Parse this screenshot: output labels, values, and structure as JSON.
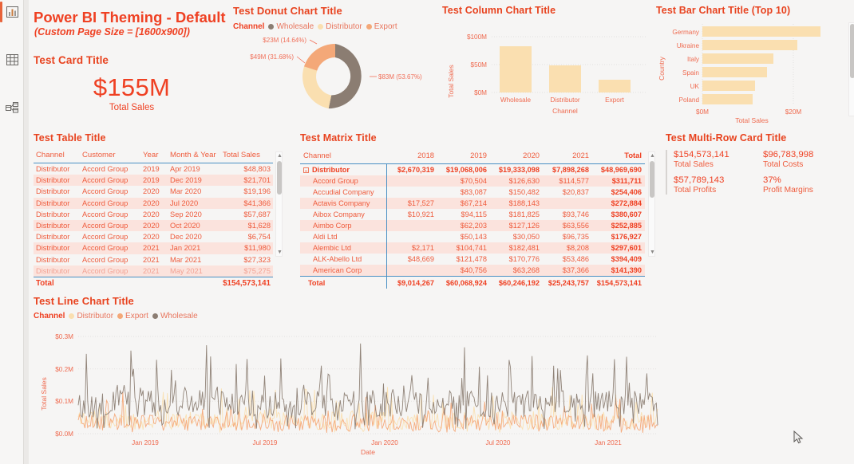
{
  "nav": {
    "items": [
      {
        "name": "report-view",
        "icon": "report-bar-icon",
        "selected": true
      },
      {
        "name": "data-view",
        "icon": "table-grid-icon",
        "selected": false
      },
      {
        "name": "model-view",
        "icon": "model-relationship-icon",
        "selected": false
      }
    ]
  },
  "page": {
    "title": "Power BI Theming - Default",
    "subtitle": "(Custom Page Size = [1600x900])",
    "accent": "#ef4123",
    "canvas_bg": "#f6f5f4"
  },
  "card": {
    "title": "Test Card Title",
    "value": "$155M",
    "label": "Total Sales"
  },
  "donut": {
    "title": "Test Donut Chart Title",
    "legend_title": "Channel"
  },
  "column": {
    "title": "Test Column Chart Title"
  },
  "bar": {
    "title": "Test Bar Chart Title (Top 10)"
  },
  "table": {
    "title": "Test Table Title",
    "columns": [
      "Channel",
      "Customer",
      "Year",
      "Month & Year",
      "Total Sales"
    ],
    "rows": [
      [
        "Distributor",
        "Accord Group",
        "2019",
        "Apr 2019",
        "$48,803"
      ],
      [
        "Distributor",
        "Accord Group",
        "2019",
        "Dec 2019",
        "$21,701"
      ],
      [
        "Distributor",
        "Accord Group",
        "2020",
        "Mar 2020",
        "$19,196"
      ],
      [
        "Distributor",
        "Accord Group",
        "2020",
        "Jul 2020",
        "$41,366"
      ],
      [
        "Distributor",
        "Accord Group",
        "2020",
        "Sep 2020",
        "$57,687"
      ],
      [
        "Distributor",
        "Accord Group",
        "2020",
        "Oct 2020",
        "$1,628"
      ],
      [
        "Distributor",
        "Accord Group",
        "2020",
        "Dec 2020",
        "$6,754"
      ],
      [
        "Distributor",
        "Accord Group",
        "2021",
        "Jan 2021",
        "$11,980"
      ],
      [
        "Distributor",
        "Accord Group",
        "2021",
        "Mar 2021",
        "$27,323"
      ],
      [
        "Distributor",
        "Accord Group",
        "2021",
        "May 2021",
        "$75,275"
      ]
    ],
    "total_label": "Total",
    "total_value": "$154,573,141"
  },
  "matrix": {
    "title": "Test Matrix Title",
    "columns": [
      "Channel",
      "2018",
      "2019",
      "2020",
      "2021",
      "Total"
    ],
    "group": {
      "label": "Distributor",
      "values": [
        "$2,670,319",
        "$19,068,006",
        "$19,333,098",
        "$7,898,268",
        "$48,969,690"
      ]
    },
    "rows": [
      {
        "label": "Accord Group",
        "values": [
          "",
          "$70,504",
          "$126,630",
          "$114,577",
          "$311,711"
        ]
      },
      {
        "label": "Accudial Company",
        "values": [
          "",
          "$83,087",
          "$150,482",
          "$20,837",
          "$254,406"
        ]
      },
      {
        "label": "Actavis Company",
        "values": [
          "$17,527",
          "$67,214",
          "$188,143",
          "",
          "$272,884"
        ]
      },
      {
        "label": "Aibox Company",
        "values": [
          "$10,921",
          "$94,115",
          "$181,825",
          "$93,746",
          "$380,607"
        ]
      },
      {
        "label": "Aimbo Corp",
        "values": [
          "",
          "$62,203",
          "$127,126",
          "$63,556",
          "$252,885"
        ]
      },
      {
        "label": "Aldi Ltd",
        "values": [
          "",
          "$50,143",
          "$30,050",
          "$96,735",
          "$176,927"
        ]
      },
      {
        "label": "Alembic Ltd",
        "values": [
          "$2,171",
          "$104,741",
          "$182,481",
          "$8,208",
          "$297,601"
        ]
      },
      {
        "label": "ALK-Abello Ltd",
        "values": [
          "$48,669",
          "$121,478",
          "$170,776",
          "$53,486",
          "$394,409"
        ]
      },
      {
        "label": "American Corp",
        "values": [
          "",
          "$40,756",
          "$63,268",
          "$37,366",
          "$141,390"
        ]
      }
    ],
    "total": {
      "label": "Total",
      "values": [
        "$9,014,267",
        "$60,068,924",
        "$60,246,192",
        "$25,243,757",
        "$154,573,141"
      ]
    }
  },
  "multirow": {
    "title": "Test Multi-Row Card Title",
    "cells": [
      {
        "value": "$154,573,141",
        "label": "Total Sales"
      },
      {
        "value": "$96,783,998",
        "label": "Total Costs"
      },
      {
        "value": "$57,789,143",
        "label": "Total Profits"
      },
      {
        "value": "37%",
        "label": "Profit Margins"
      }
    ]
  },
  "line": {
    "title": "Test Line Chart Title",
    "legend_title": "Channel"
  },
  "colors": {
    "wholesale": "#8b7d72",
    "distributor": "#fadfb0",
    "export": "#f4a878",
    "bar_fill": "#fadfb0",
    "text": "#ef5b3c",
    "title": "#ef4123"
  },
  "chart_data": [
    {
      "type": "pie",
      "name": "donut",
      "title": "Test Donut Chart Title",
      "legend_title": "Channel",
      "legend_position": "top",
      "labels": [
        "Wholesale",
        "Distributor",
        "Export"
      ],
      "values": [
        83,
        49,
        23
      ],
      "percents": [
        53.67,
        31.68,
        14.64
      ],
      "data_labels": [
        "$83M (53.67%)",
        "$49M (31.68%)",
        "$23M (14.64%)"
      ],
      "colors": [
        "#8b7d72",
        "#fadfb0",
        "#f4a878"
      ]
    },
    {
      "type": "bar",
      "name": "column-chart",
      "title": "Test Column Chart Title",
      "categories": [
        "Wholesale",
        "Distributor",
        "Export"
      ],
      "values": [
        83,
        49,
        23
      ],
      "xlabel": "Channel",
      "ylabel": "Total Sales",
      "ylim": [
        0,
        100
      ],
      "yticks": [
        0,
        50,
        100
      ],
      "ytick_labels": [
        "$0M",
        "$50M",
        "$100M"
      ],
      "grid": true,
      "color": "#fadfb0"
    },
    {
      "type": "bar",
      "name": "bar-chart-top10",
      "orientation": "horizontal",
      "title": "Test Bar Chart Title (Top 10)",
      "categories": [
        "Germany",
        "Ukraine",
        "Italy",
        "Spain",
        "UK",
        "Poland"
      ],
      "values": [
        25.9,
        20.9,
        15.6,
        14.2,
        11.5,
        11.1
      ],
      "xlabel": "Total Sales",
      "ylabel": "Country",
      "xlim": [
        0,
        30
      ],
      "xticks": [
        0,
        20
      ],
      "xtick_labels": [
        "$0M",
        "$20M"
      ],
      "grid": true,
      "color": "#fadfb0",
      "scrollable": true
    },
    {
      "type": "line",
      "name": "line-chart",
      "title": "Test Line Chart Title",
      "legend_title": "Channel",
      "legend_position": "top",
      "xlabel": "Date",
      "ylabel": "Total Sales",
      "ylim": [
        0,
        0.3
      ],
      "yticks": [
        0,
        0.1,
        0.2,
        0.3
      ],
      "ytick_labels": [
        "$0.0M",
        "$0.1M",
        "$0.2M",
        "$0.3M"
      ],
      "xtick_labels": [
        "Jan 2019",
        "Jul 2019",
        "Jan 2020",
        "Jul 2020",
        "Jan 2021"
      ],
      "grid": true,
      "series": [
        {
          "name": "Distributor",
          "color": "#fadfb0"
        },
        {
          "name": "Export",
          "color": "#f4a878"
        },
        {
          "name": "Wholesale",
          "color": "#8b7d72"
        }
      ]
    },
    {
      "type": "table",
      "name": "table-visual",
      "title": "Test Table Title",
      "columns": [
        "Channel",
        "Customer",
        "Year",
        "Month & Year",
        "Total Sales"
      ],
      "rows": [
        [
          "Distributor",
          "Accord Group",
          "2019",
          "Apr 2019",
          "$48,803"
        ],
        [
          "Distributor",
          "Accord Group",
          "2019",
          "Dec 2019",
          "$21,701"
        ],
        [
          "Distributor",
          "Accord Group",
          "2020",
          "Mar 2020",
          "$19,196"
        ],
        [
          "Distributor",
          "Accord Group",
          "2020",
          "Jul 2020",
          "$41,366"
        ],
        [
          "Distributor",
          "Accord Group",
          "2020",
          "Sep 2020",
          "$57,687"
        ],
        [
          "Distributor",
          "Accord Group",
          "2020",
          "Oct 2020",
          "$1,628"
        ],
        [
          "Distributor",
          "Accord Group",
          "2020",
          "Dec 2020",
          "$6,754"
        ],
        [
          "Distributor",
          "Accord Group",
          "2021",
          "Jan 2021",
          "$11,980"
        ],
        [
          "Distributor",
          "Accord Group",
          "2021",
          "Mar 2021",
          "$27,323"
        ],
        [
          "Distributor",
          "Accord Group",
          "2021",
          "May 2021",
          "$75,275"
        ]
      ],
      "total_row": [
        "Total",
        "",
        "",
        "",
        "$154,573,141"
      ]
    },
    {
      "type": "table",
      "name": "matrix-visual",
      "title": "Test Matrix Title",
      "columns": [
        "Channel",
        "2018",
        "2019",
        "2020",
        "2021",
        "Total"
      ],
      "rows": [
        [
          "Distributor",
          "$2,670,319",
          "$19,068,006",
          "$19,333,098",
          "$7,898,268",
          "$48,969,690"
        ],
        [
          "Accord Group",
          "",
          "$70,504",
          "$126,630",
          "$114,577",
          "$311,711"
        ],
        [
          "Accudial Company",
          "",
          "$83,087",
          "$150,482",
          "$20,837",
          "$254,406"
        ],
        [
          "Actavis Company",
          "$17,527",
          "$67,214",
          "$188,143",
          "",
          "$272,884"
        ],
        [
          "Aibox Company",
          "$10,921",
          "$94,115",
          "$181,825",
          "$93,746",
          "$380,607"
        ],
        [
          "Aimbo Corp",
          "",
          "$62,203",
          "$127,126",
          "$63,556",
          "$252,885"
        ],
        [
          "Aldi Ltd",
          "",
          "$50,143",
          "$30,050",
          "$96,735",
          "$176,927"
        ],
        [
          "Alembic Ltd",
          "$2,171",
          "$104,741",
          "$182,481",
          "$8,208",
          "$297,601"
        ],
        [
          "ALK-Abello Ltd",
          "$48,669",
          "$121,478",
          "$170,776",
          "$53,486",
          "$394,409"
        ],
        [
          "American Corp",
          "",
          "$40,756",
          "$63,268",
          "$37,366",
          "$141,390"
        ]
      ],
      "total_row": [
        "Total",
        "$9,014,267",
        "$60,068,924",
        "$60,246,192",
        "$25,243,757",
        "$154,573,141"
      ]
    }
  ]
}
